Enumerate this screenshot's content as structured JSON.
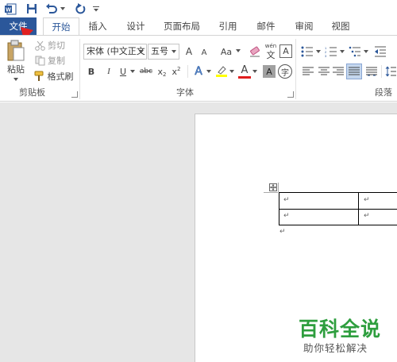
{
  "qat": {
    "app_icon": "word-app-icon",
    "save_icon": "save-icon",
    "undo_icon": "undo-icon",
    "redo_icon": "redo-icon",
    "customize_icon": "customize-qat-icon"
  },
  "tabs": [
    {
      "label": "文件"
    },
    {
      "label": "开始"
    },
    {
      "label": "插入"
    },
    {
      "label": "设计"
    },
    {
      "label": "页面布局"
    },
    {
      "label": "引用"
    },
    {
      "label": "邮件"
    },
    {
      "label": "审阅"
    },
    {
      "label": "视图"
    }
  ],
  "clipboard": {
    "paste_label": "粘贴",
    "cut_label": "剪切",
    "copy_label": "复制",
    "format_painter_label": "格式刷",
    "group_label": "剪贴板"
  },
  "font": {
    "font_name": "宋体 (中文正文",
    "font_size": "五号",
    "grow_font": "A",
    "shrink_font": "A",
    "change_case": "Aa",
    "phonetic_guide": "wén",
    "phonetic_char": "文",
    "char_border": "A",
    "bold": "B",
    "italic": "I",
    "underline": "U",
    "strikethrough": "abc",
    "subscript": "x",
    "subscript_mark": "2",
    "superscript": "x",
    "superscript_mark": "2",
    "text_effects": "A",
    "font_color": "A",
    "char_shading": "A",
    "enclose_char": "字",
    "group_label": "字体"
  },
  "paragraph": {
    "group_label": "段落"
  },
  "document": {
    "cell_marks": [
      "↵",
      "↵",
      "↵",
      "↵"
    ],
    "after_table_mark": "↵"
  },
  "watermark": {
    "title": "百科全说",
    "subtitle": "助你轻松解决"
  },
  "colors": {
    "accent": "#2b579a",
    "highlight": "#ffff00",
    "font_color": "#e11d1d",
    "watermark": "#2e9e3e",
    "arrow": "#e02020"
  }
}
